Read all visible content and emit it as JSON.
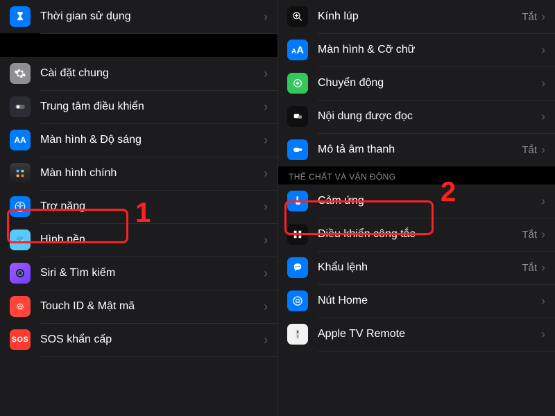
{
  "left_panel": {
    "items": [
      {
        "label": "Thời gian sử dụng",
        "icon": "hourglass",
        "icon_bg": "ic-blue"
      },
      {
        "label": "Cài đặt chung",
        "icon": "gear",
        "icon_bg": "ic-gray"
      },
      {
        "label": "Trung tâm điều khiển",
        "icon": "toggle",
        "icon_bg": "ic-dark"
      },
      {
        "label": "Màn hình & Độ sáng",
        "icon": "AA",
        "icon_bg": "ic-blue"
      },
      {
        "label": "Màn hình chính",
        "icon": "grid",
        "icon_bg": "ic-gradient-home"
      },
      {
        "label": "Trợ năng",
        "icon": "accessibility",
        "icon_bg": "ic-blue"
      },
      {
        "label": "Hình nền",
        "icon": "wallpaper",
        "icon_bg": "ic-cyan"
      },
      {
        "label": "Siri & Tìm kiếm",
        "icon": "siri",
        "icon_bg": "ic-purple"
      },
      {
        "label": "Touch ID & Mật mã",
        "icon": "fingerprint",
        "icon_bg": "ic-redorange"
      },
      {
        "label": "SOS khẩn cấp",
        "icon": "SOS",
        "icon_bg": "ic-sos"
      }
    ]
  },
  "right_panel": {
    "items_a": [
      {
        "label": "Kính lúp",
        "icon": "magnifier-plus",
        "icon_bg": "ic-black",
        "value": "Tắt"
      },
      {
        "label": "Màn hình & Cỡ chữ",
        "icon": "AA",
        "icon_bg": "ic-blue",
        "value": ""
      },
      {
        "label": "Chuyển động",
        "icon": "motion",
        "icon_bg": "ic-green",
        "value": ""
      },
      {
        "label": "Nội dung được đọc",
        "icon": "speech",
        "icon_bg": "ic-black",
        "value": ""
      },
      {
        "label": "Mô tả âm thanh",
        "icon": "audio-desc",
        "icon_bg": "ic-blue",
        "value": "Tắt"
      }
    ],
    "section_header": "THỂ CHẤT VÀ VẬN ĐỘNG",
    "items_b": [
      {
        "label": "Cảm ứng",
        "icon": "touch",
        "icon_bg": "ic-blue",
        "value": ""
      },
      {
        "label": "Điều khiển công tắc",
        "icon": "switch-grid",
        "icon_bg": "ic-black",
        "value": "Tắt"
      },
      {
        "label": "Khẩu lệnh",
        "icon": "voice",
        "icon_bg": "ic-blue",
        "value": "Tắt"
      },
      {
        "label": "Nút Home",
        "icon": "home-button",
        "icon_bg": "ic-blue",
        "value": ""
      },
      {
        "label": "Apple TV Remote",
        "icon": "remote",
        "icon_bg": "ic-white",
        "value": ""
      }
    ]
  },
  "annotations": {
    "one": "1",
    "two": "2"
  }
}
